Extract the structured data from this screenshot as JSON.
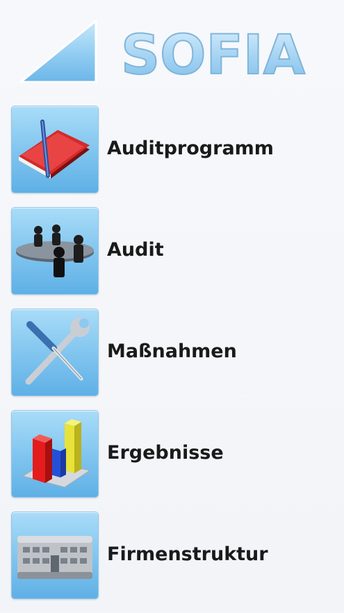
{
  "logo": {
    "text": "SOFIA"
  },
  "menu": {
    "items": [
      {
        "label": "Auditprogramm",
        "icon": "red-book-pen-icon"
      },
      {
        "label": "Audit",
        "icon": "meeting-table-icon"
      },
      {
        "label": "Maßnahmen",
        "icon": "wrench-screwdriver-icon"
      },
      {
        "label": "Ergebnisse",
        "icon": "bar-chart-3d-icon"
      },
      {
        "label": "Firmenstruktur",
        "icon": "office-building-icon"
      }
    ]
  },
  "colors": {
    "tile_top": "#a9dcf8",
    "tile_bottom": "#5fb0e6",
    "logo_blue": "#9fcfee",
    "label_text": "#1a1a1a"
  }
}
